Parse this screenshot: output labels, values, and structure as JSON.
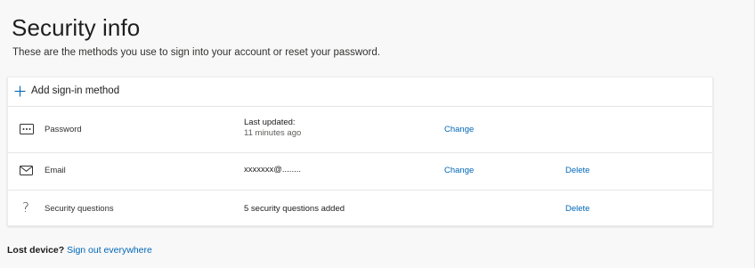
{
  "page": {
    "title": "Security info",
    "subtitle": "These are the methods you use to sign into your account or reset your password."
  },
  "add_method": {
    "label": "Add sign-in method",
    "icon": "plus-icon"
  },
  "methods": [
    {
      "icon": "password-icon",
      "name": "Password",
      "detail": "Last updated:",
      "detail_sub": "11 minutes ago",
      "change_label": "Change",
      "delete_label": ""
    },
    {
      "icon": "email-icon",
      "name": "Email",
      "detail": "xxxxxxx@........",
      "detail_sub": "",
      "change_label": "Change",
      "delete_label": "Delete"
    },
    {
      "icon": "question-icon",
      "name": "Security questions",
      "detail": "5 security questions added",
      "detail_sub": "",
      "change_label": "",
      "delete_label": "Delete"
    }
  ],
  "footer": {
    "lost_device": "Lost device?",
    "sign_out": "Sign out everywhere"
  },
  "colors": {
    "link": "#0067b8",
    "background": "#f8f8f8",
    "card": "#ffffff"
  }
}
